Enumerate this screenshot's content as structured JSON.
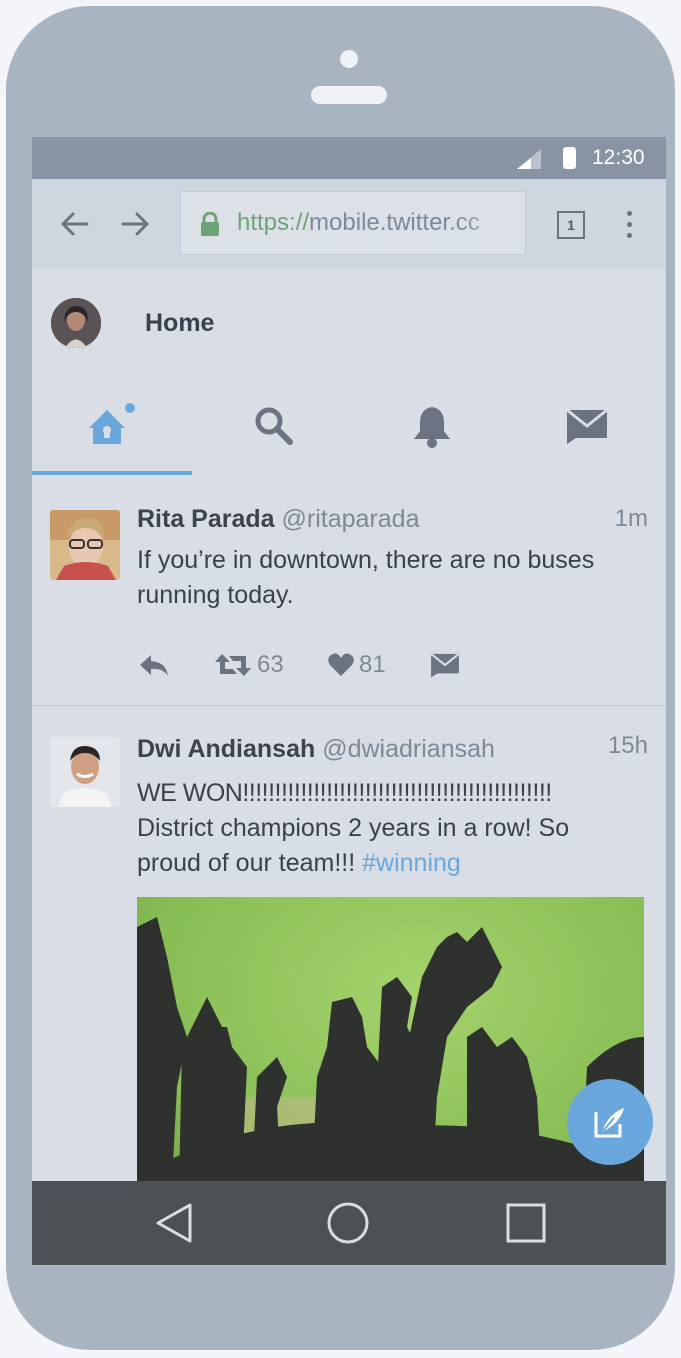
{
  "status_bar": {
    "time": "12:30"
  },
  "browser": {
    "url_scheme": "https://",
    "url_host": "mobile.twitter.cc",
    "tab_count": "1"
  },
  "header": {
    "title": "Home"
  },
  "nav_tabs": [
    "home-icon",
    "search-icon",
    "notifications-icon",
    "messages-icon"
  ],
  "tweets": [
    {
      "name": "Rita Parada",
      "handle": "@ritaparada",
      "time": "1m",
      "text": "If you’re in downtown, there are no buses running today.",
      "retweets": "63",
      "likes": "81"
    },
    {
      "name": "Dwi Andiansah",
      "handle": "@dwiadriansah",
      "time": "15h",
      "text_line1": "WE WON!!!!!!!!!!!!!!!!!!!!!!!!!!!!!!!!!!!!!!!!!!!!!!!!",
      "text_line2": "District champions 2 years in a row! So proud of our team!!! ",
      "hashtag": "#winning"
    }
  ],
  "colors": {
    "accent": "#6aa7dc",
    "screen_bg": "#d9dee6",
    "device": "#a9b4c1",
    "nav_bar": "#4d5154"
  }
}
